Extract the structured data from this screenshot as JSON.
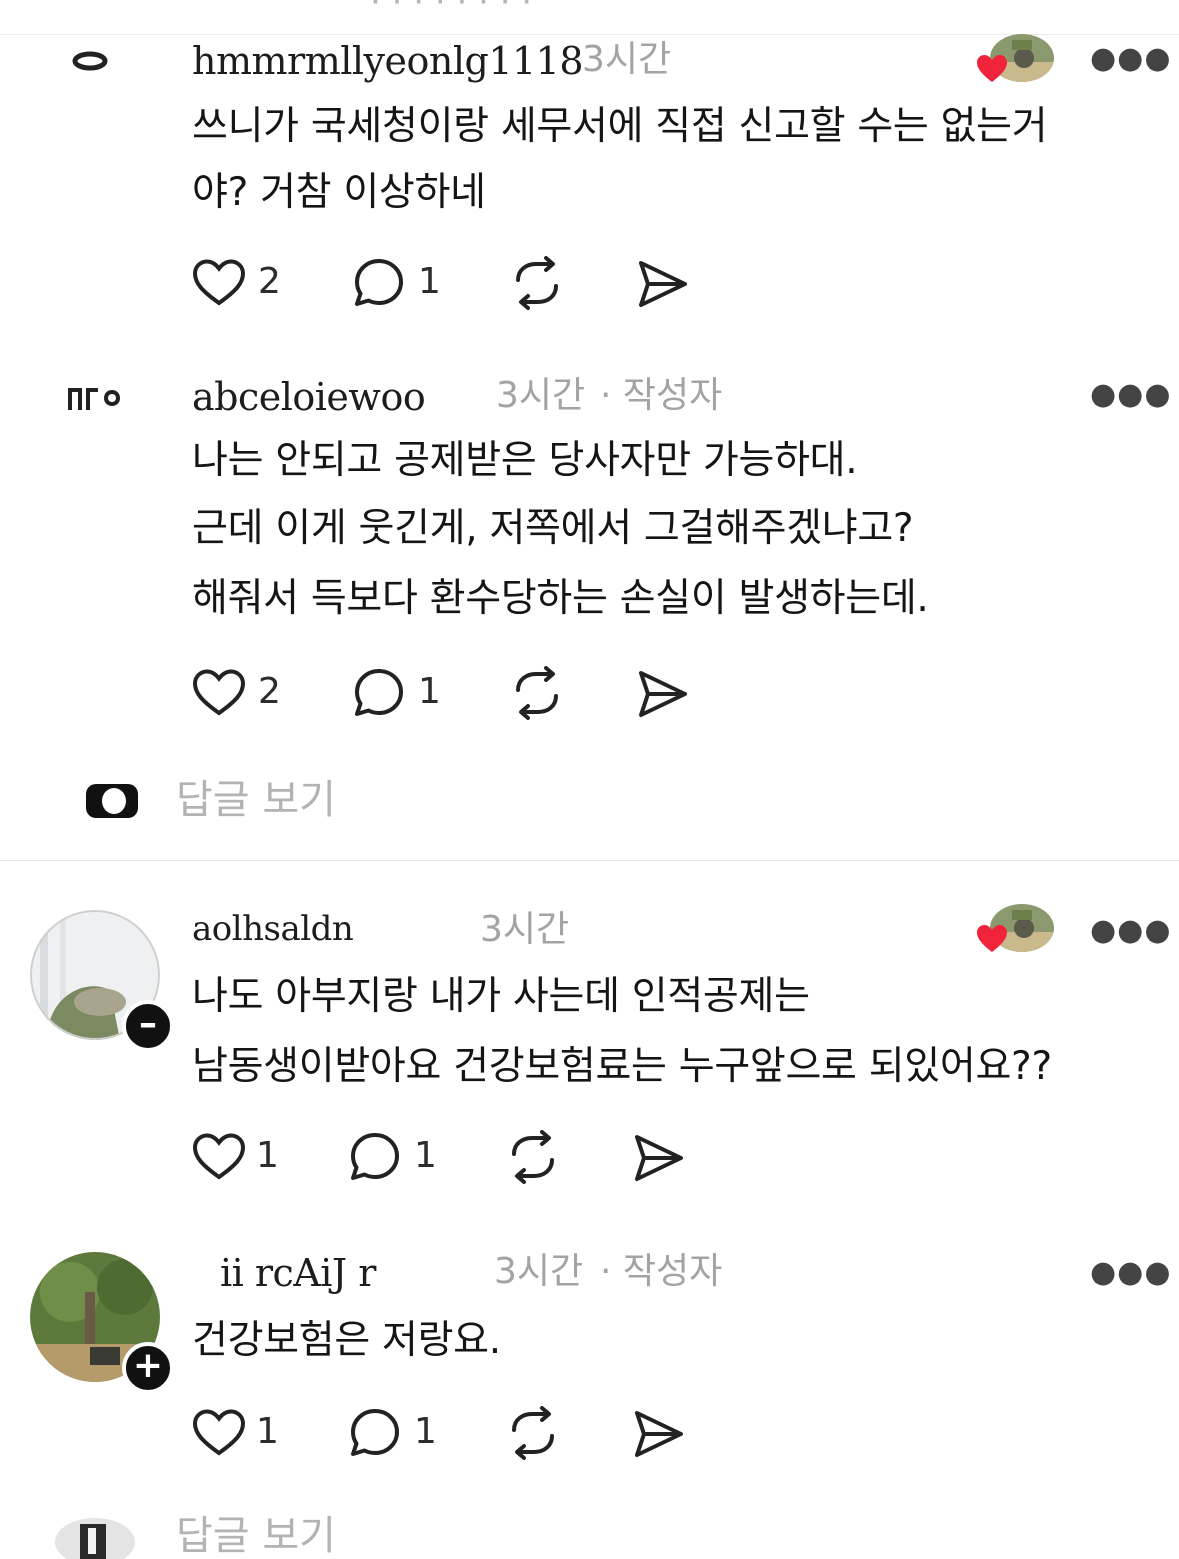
{
  "top_partial_text": "·  ·  ·  ·  ·  ·  ·  ·",
  "comments": [
    {
      "username": "hmmrmllyeonlg1118",
      "time": "3시간",
      "author_tag": "",
      "text_lines": [
        "쓰니가 국세청이랑 세무서에 직접 신고할 수는 없는거",
        "야? 거참 이상하네"
      ],
      "likes": "2",
      "replies": "1",
      "liked_by_author": true
    },
    {
      "username": "abceloiewoo",
      "time": "3시간",
      "author_tag": "· 작성자",
      "text_lines": [
        "나는 안되고 공제받은 당사자만 가능하대.",
        "근데 이게 웃긴게, 저쪽에서 그걸해주겠냐고?",
        "해줘서 득보다 환수당하는 손실이 발생하는데."
      ],
      "likes": "2",
      "replies": "1",
      "liked_by_author": false
    },
    {
      "username": "aolhsaldn",
      "time": "3시간",
      "author_tag": "",
      "text_lines": [
        "나도 아부지랑 내가 사는데 인적공제는",
        "남동생이받아요 건강보험료는 누구앞으로 되있어요??"
      ],
      "likes": "1",
      "replies": "1",
      "liked_by_author": true
    },
    {
      "username": "ii  rcAiJ  r",
      "time": "3시간",
      "author_tag": "· 작성자",
      "text_lines": [
        "건강보험은 저랑요."
      ],
      "likes": "1",
      "replies": "1",
      "liked_by_author": false
    }
  ],
  "view_replies_label": "답글 보기",
  "icons": {
    "like": "heart-outline-icon",
    "reply": "speech-bubble-icon",
    "repost": "repost-icon",
    "share": "send-icon",
    "more": "more-horizontal-icon"
  },
  "colors": {
    "heart": "#f0233a",
    "meta_gray": "#a3a3a3",
    "text": "#151515"
  }
}
